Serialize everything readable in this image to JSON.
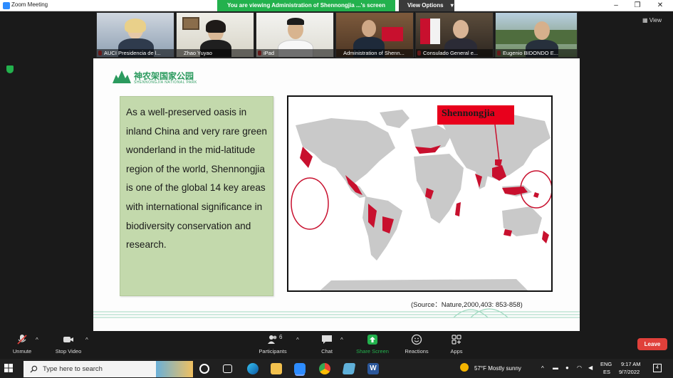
{
  "window": {
    "title": "Zoom Meeting",
    "share_banner": "You are viewing Administration of Shennongjia ...'s screen",
    "view_options": "View Options",
    "view_label": "View"
  },
  "participants": [
    {
      "name": "AUCI Presidencia de l...",
      "muted": true
    },
    {
      "name": "Zhao Yuyao",
      "muted": false
    },
    {
      "name": "iPad",
      "muted": true
    },
    {
      "name": "Administration of Shenn...",
      "muted": false
    },
    {
      "name": "Consulado General e...",
      "muted": true
    },
    {
      "name": "Eugenio BIDONDO E...",
      "muted": true
    }
  ],
  "slide": {
    "logo_cn": "神农架国家公园",
    "logo_en": "SHENNONGJIA NATIONAL PARK",
    "body_text": "As a well-preserved oasis in inland China and very rare green wonderland in the mid-latitude region of the world, Shennongjia is one of the global 14 key areas with international significance in biodiversity conservation and research.",
    "map_callout": "Shennongjia",
    "source": "(Source：Nature,2000,403: 853-858)"
  },
  "toolbar": {
    "unmute": "Unmute",
    "stop_video": "Stop Video",
    "participants": "Participants",
    "participants_count": "6",
    "chat": "Chat",
    "share_screen": "Share Screen",
    "reactions": "Reactions",
    "apps": "Apps",
    "leave": "Leave"
  },
  "taskbar": {
    "search_placeholder": "Type here to search",
    "weather": "57°F  Mostly sunny",
    "lang_top": "ENG",
    "lang_bottom": "ES",
    "time": "9:17 AM",
    "date": "9/7/2022",
    "notif_count": "4"
  },
  "colors": {
    "share_green": "#23b14d",
    "slide_green_box": "#c3d9ac",
    "map_red": "#c8102e",
    "leave_red": "#e0403a"
  }
}
